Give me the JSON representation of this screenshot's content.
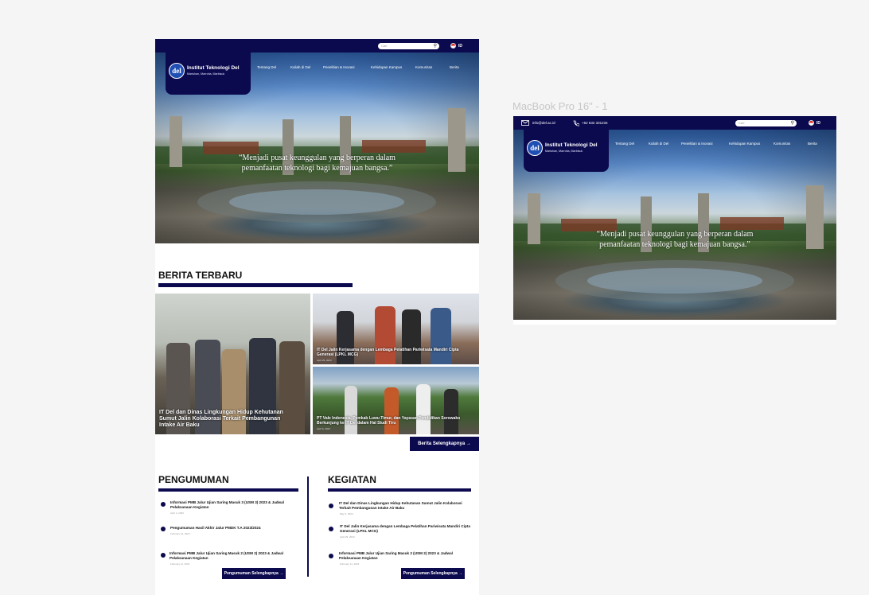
{
  "canvas": {
    "background": "#f5f5f5"
  },
  "colors": {
    "brand_navy": "#0c0a4f",
    "white": "#ffffff"
  },
  "header": {
    "search_placeholder": "Cari",
    "language": "ID",
    "logo_mark": "del",
    "logo_name": "Institut Teknologi Del",
    "logo_tagline": "Martuhan, Marroha, Marbisuk",
    "email": "info@del.ac.id",
    "phone": "+62 632 331234"
  },
  "nav": {
    "items": [
      "Tentang Del",
      "Kuliah di Del",
      "Penelitian & Inovasi",
      "Kehidupan Kampus",
      "Komunitas",
      "Berita"
    ]
  },
  "hero": {
    "quote_line1": "“Menjadi pusat keunggulan yang berperan dalam",
    "quote_line2": "pemanfaatan teknologi bagi kemajuan bangsa.”"
  },
  "news": {
    "title": "BERITA TERBARU",
    "items": [
      {
        "title": "IT Del dan Dinas Lingkungan Hidup Kehutanan Sumut Jalin Kolaborasi Terkait Pembangunan Intake Air Baku"
      },
      {
        "title": "IT Del Jalin Kerjasama dengan Lembaga Pelatihan Pariwisata Mandiri Cipta Generasi (LPKL MCG)",
        "date": "April 29, 2023"
      },
      {
        "title": "PT Vale Indonesia, Pemkab Luwu Timur, dan Yayasan Pendidikan Sorowako Berkunjung ke IT Del dalam Hal Studi Tiru",
        "date": "April 6, 2023"
      }
    ],
    "more_label": "Berita Selengkapnya →"
  },
  "announcements": {
    "title": "PENGUMUMAN",
    "items": [
      {
        "title": "Informasi PMB Jalur Ujian Saring Masuk 3 (USM 3) 2023 & Jadwal Pelaksanaan Kegiatan",
        "date": "April 4, 2023"
      },
      {
        "title": "Pengumuman Hasil Akhir Jalur PMDK T.A 2023/2024",
        "date": "February 13, 2023"
      },
      {
        "title": "Informasi PMB Jalur Ujian Saring Masuk 2 (USM 2) 2023 & Jadwal Pelaksanaan Kegiatan",
        "date": "February 11, 2023"
      }
    ],
    "more_label": "Pengumuman Selengkapnya →"
  },
  "activities": {
    "title": "KEGIATAN",
    "items": [
      {
        "title": "IT Del dan Dinas Lingkungan Hidup Kehutanan Sumut Jalin Kolaborasi Terkait Pembangunan Intake Air Baku",
        "date": "May 3, 2023"
      },
      {
        "title": "IT Del Jalin Kerjasama dengan Lembaga Pelatihan Pariwisata Mandiri Cipta Generasi (LPKL MCG)",
        "date": "April 29, 2023"
      },
      {
        "title": "Informasi PMB Jalur Ujian Saring Masuk 2 (USM 2) 2023 & Jadwal Pelaksanaan Kegiatan",
        "date": "February 11, 2023"
      }
    ],
    "more_label": "Pengumuman Selengkapnya →"
  },
  "frame2": {
    "label": "MacBook Pro 16\" - 1"
  }
}
